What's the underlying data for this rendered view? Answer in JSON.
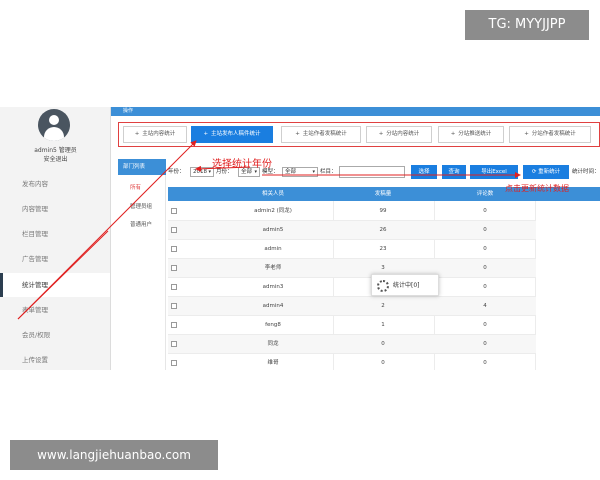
{
  "watermarks": {
    "top_right": "TG: MYYJJPP",
    "bottom_left": "www.langjiehuanbao.com"
  },
  "colors": {
    "accent": "#3c8fd7",
    "active_tab": "#1a7ee0",
    "annotation": "#e02020"
  },
  "sidebar": {
    "user_name": "admin5 管理员",
    "logout": "安全退出",
    "items": [
      {
        "label": "发布内容",
        "active": false
      },
      {
        "label": "内容管理",
        "active": false
      },
      {
        "label": "栏目管理",
        "active": false
      },
      {
        "label": "广告管理",
        "active": false
      },
      {
        "label": "统计管理",
        "active": true
      },
      {
        "label": "表单管理",
        "active": false
      },
      {
        "label": "会员/权限",
        "active": false
      },
      {
        "label": "上传设置",
        "active": false
      }
    ]
  },
  "topbar": {
    "title": "操作"
  },
  "tabs": [
    {
      "label": "主站内容统计",
      "active": false
    },
    {
      "label": "主站发布人稿件统计",
      "active": true
    },
    {
      "label": "主站作者发稿统计",
      "active": false
    },
    {
      "label": "分站内容统计",
      "active": false
    },
    {
      "label": "分站推送统计",
      "active": false
    },
    {
      "label": "分站作者发稿统计",
      "active": false
    }
  ],
  "departments": {
    "header": "部门列表",
    "items": [
      {
        "label": "所有",
        "active": true
      },
      {
        "label": "管理员组",
        "active": false
      },
      {
        "label": "普通用户",
        "active": false
      }
    ]
  },
  "filters": {
    "year_label": "年份：",
    "year_value": "2018",
    "month_label": "月份：",
    "month_value": "全部",
    "model_label": "模型：",
    "model_value": "全部",
    "column_label": "栏目：",
    "column_value": "",
    "buttons": {
      "select": "选择",
      "query": "查询",
      "export": "导出Excel",
      "recount": "重新统计"
    },
    "stat_time_label": "统计时间："
  },
  "annotations": {
    "select_year": "选择统计年份",
    "update_data": "点击更新统计数据"
  },
  "table": {
    "headers": [
      "相关人员",
      "发稿量",
      "评论数"
    ],
    "rows": [
      {
        "name": "admin2 (同龙)",
        "posts": "99",
        "comments": "0"
      },
      {
        "name": "admin5",
        "posts": "26",
        "comments": "0"
      },
      {
        "name": "admin",
        "posts": "23",
        "comments": "0"
      },
      {
        "name": "李老师",
        "posts": "3",
        "comments": "0"
      },
      {
        "name": "admin3",
        "posts": "",
        "comments": "0"
      },
      {
        "name": "admin4",
        "posts": "2",
        "comments": "4"
      },
      {
        "name": "feng8",
        "posts": "1",
        "comments": "0"
      },
      {
        "name": "同龙",
        "posts": "0",
        "comments": "0"
      },
      {
        "name": "维哥",
        "posts": "0",
        "comments": "0"
      }
    ]
  },
  "loading": {
    "text": "统计中[0]"
  }
}
